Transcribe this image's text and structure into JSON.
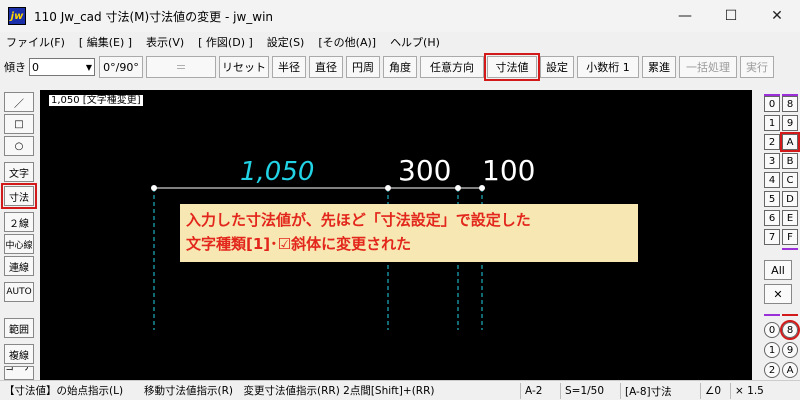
{
  "window": {
    "title": "110 Jw_cad 寸法(M)寸法値の変更 - jw_win",
    "icon_text": "jw",
    "minimize": "—",
    "maximize": "☐",
    "close": "✕"
  },
  "menu": [
    "ファイル(F)",
    "[ 編集(E) ]",
    "表示(V)",
    "[ 作図(D) ]",
    "設定(S)",
    "[その他(A)]",
    "ヘルプ(H)"
  ],
  "toolbar": {
    "tilt_label": "傾き",
    "tilt_value": "0",
    "buttons": {
      "deg": "0°/90°",
      "equal": "＝",
      "reset": "リセット",
      "radius": "半径",
      "diameter": "直径",
      "circumference": "円周",
      "angle": "角度",
      "arbitrary": "任意方向",
      "dimvalue": "寸法値",
      "settings": "設定",
      "decimal": "小数桁 1",
      "cumulative": "累進",
      "batch": "一括処理",
      "execute": "実行"
    }
  },
  "left_tools": [
    "／",
    "□",
    "○",
    "文字",
    "寸法",
    "２線",
    "中心線",
    "連線",
    "AUTO",
    "範囲",
    "複線",
    "コーナー"
  ],
  "canvas": {
    "tag": "1,050 [文字種変更]",
    "dim_value_italic": "1,050",
    "dim_value_1": "300",
    "dim_value_2": "100",
    "callout_line1": "入力した寸法値が、先ほど「寸法設定」で設定した",
    "callout_line2": "文字種類[1]･☑斜体に変更された",
    "colors": {
      "background": "#000000",
      "cyan": "#22d3e6",
      "white": "#ffffff",
      "callout_bg": "#f7e8b3",
      "callout_text": "#e3261b",
      "highlight": "#d21a1a"
    }
  },
  "right_tools": {
    "left_col": [
      "0",
      "1",
      "2",
      "3",
      "4",
      "5",
      "6",
      "7"
    ],
    "right_col": [
      "8",
      "9",
      "A",
      "B",
      "C",
      "D",
      "E",
      "F"
    ],
    "all": "All",
    "cross": "✕",
    "circle_left": [
      "0",
      "1",
      "2"
    ],
    "circle_right": [
      "8",
      "9",
      "A"
    ]
  },
  "status": {
    "message": "【寸法値】の始点指示(L)　　移動寸法値指示(R)　変更寸法値指示(RR) 2点間[Shift]+(RR)",
    "layer": "A-2",
    "scale": "S=1/50",
    "group": "[A-8]寸法",
    "angle": "∠0",
    "zoom": "× 1.5"
  }
}
